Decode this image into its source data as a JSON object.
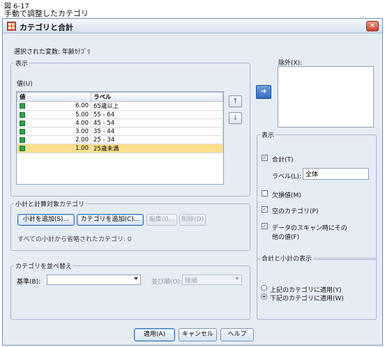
{
  "caption": {
    "line1": "図 6-17",
    "line2": "手動で調整したカテゴリ"
  },
  "window": {
    "title": "カテゴリと合計",
    "close_glyph": "✕"
  },
  "selected_variable": "選択された変数: 年齢ｶﾃｺﾞﾘ",
  "display_group": {
    "label": "表示",
    "values_label": "値(U)",
    "columns": [
      "値",
      "ラベル"
    ],
    "rows": [
      {
        "value": "6.00",
        "label": "65歳以上",
        "selected": false
      },
      {
        "value": "5.00",
        "label": "55 - 64",
        "selected": false
      },
      {
        "value": "4.00",
        "label": "45 - 54",
        "selected": false
      },
      {
        "value": "3.00",
        "label": "35 - 44",
        "selected": false
      },
      {
        "value": "2.00",
        "label": "25 - 34",
        "selected": false
      },
      {
        "value": "1.00",
        "label": "25歳未満",
        "selected": true
      }
    ],
    "move_up_glyph": "↑",
    "move_down_glyph": "↓"
  },
  "exclude": {
    "arrow_glyph": "➜",
    "label": "除外(X):"
  },
  "subtotal_group": {
    "label": "小計と計算対象カテゴリ",
    "add_subtotal": "小計を追加(S)...",
    "add_category": "カテゴリを追加(C)...",
    "edit": "編集(I)...",
    "delete": "削除(D)",
    "note": "すべての小計から省略されたカテゴリ: 0"
  },
  "sort_group": {
    "label": "カテゴリを並べ替え",
    "basis_label": "基準(B):",
    "basis_value": "",
    "order_label": "並び順(O):",
    "order_value": "降順"
  },
  "show_group": {
    "label": "表示",
    "total_label": "合計(T)",
    "total_checked": true,
    "label_label": "ラベル(L):",
    "label_value": "全体",
    "missing_label": "欠損値(M)",
    "missing_checked": false,
    "empty_label": "空のカテゴリ(P)",
    "empty_checked": true,
    "scan_line1": "データのスキャン時にその",
    "scan_line2": "他の値(F)",
    "scan_checked": true
  },
  "total_display_group": {
    "label": "合計と小計の表示",
    "above": "上記のカテゴリに適用(Y)",
    "below": "下記のカテゴリに適用(W)",
    "selected": "below"
  },
  "footer": {
    "apply": "適用(A)",
    "cancel": "キャンセル",
    "help": "ヘルプ"
  }
}
